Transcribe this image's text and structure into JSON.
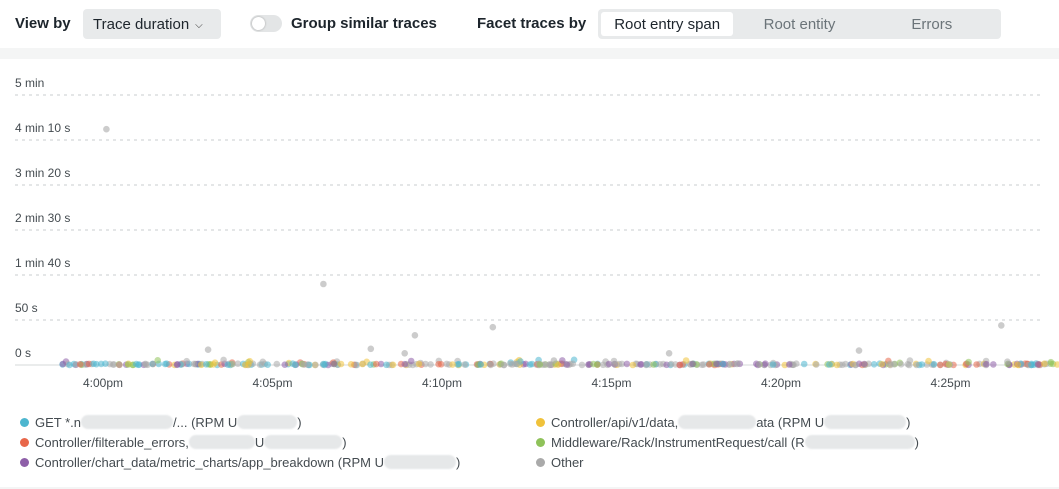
{
  "toolbar": {
    "view_by_label": "View by",
    "view_by_value": "Trace duration",
    "group_label": "Group similar traces",
    "group_enabled": false,
    "facet_label": "Facet traces by",
    "facet_options": [
      "Root entry span",
      "Root entity",
      "Errors"
    ],
    "facet_selected": "Root entry span"
  },
  "chart_data": {
    "type": "scatter",
    "y_ticks": [
      "5 min",
      "4 min 10 s",
      "3 min 20 s",
      "2 min 30 s",
      "1 min 40 s",
      "50 s",
      "0 s"
    ],
    "x_ticks": [
      "4:00pm",
      "4:05pm",
      "4:10pm",
      "4:15pm",
      "4:20pm",
      "4:25pm"
    ],
    "ylim_seconds": [
      0,
      300
    ],
    "xlim_minutes": [
      -1.5,
      28.5
    ],
    "grid": true,
    "legend_placement": "bottom",
    "series": [
      {
        "name": "GET *.n",
        "name_suffix": "/... (RPM U",
        "name_end": ")",
        "color": "#4db6cf"
      },
      {
        "name": "Controller/filterable_errors,",
        "name_suffix": "U",
        "name_end": ")",
        "color": "#e8674a"
      },
      {
        "name": "Controller/chart_data/metric_charts/app_breakdown (RPM U",
        "name_suffix": "",
        "name_end": ")",
        "color": "#8e5fa8"
      },
      {
        "name": "Controller/api/v1/data,",
        "name_suffix": "ata (RPM U",
        "name_end": ")",
        "color": "#f0c23b"
      },
      {
        "name": "Middleware/Rack/InstrumentRequest/call (R",
        "name_suffix": "",
        "name_end": ")",
        "color": "#8fc25a"
      },
      {
        "name": "Other",
        "name_suffix": "",
        "name_end": "",
        "color": "#aaaaaa"
      }
    ],
    "outliers": [
      {
        "t": 0.1,
        "s": 262
      },
      {
        "t": 6.5,
        "s": 90
      },
      {
        "t": 9.2,
        "s": 33
      },
      {
        "t": 11.5,
        "s": 42
      },
      {
        "t": 8.9,
        "s": 13
      },
      {
        "t": 13.3,
        "s": 5
      },
      {
        "t": 16.7,
        "s": 13
      },
      {
        "t": 22.3,
        "s": 16
      },
      {
        "t": 26.5,
        "s": 44
      },
      {
        "t": 3.1,
        "s": 17
      },
      {
        "t": 7.9,
        "s": 18
      }
    ]
  }
}
